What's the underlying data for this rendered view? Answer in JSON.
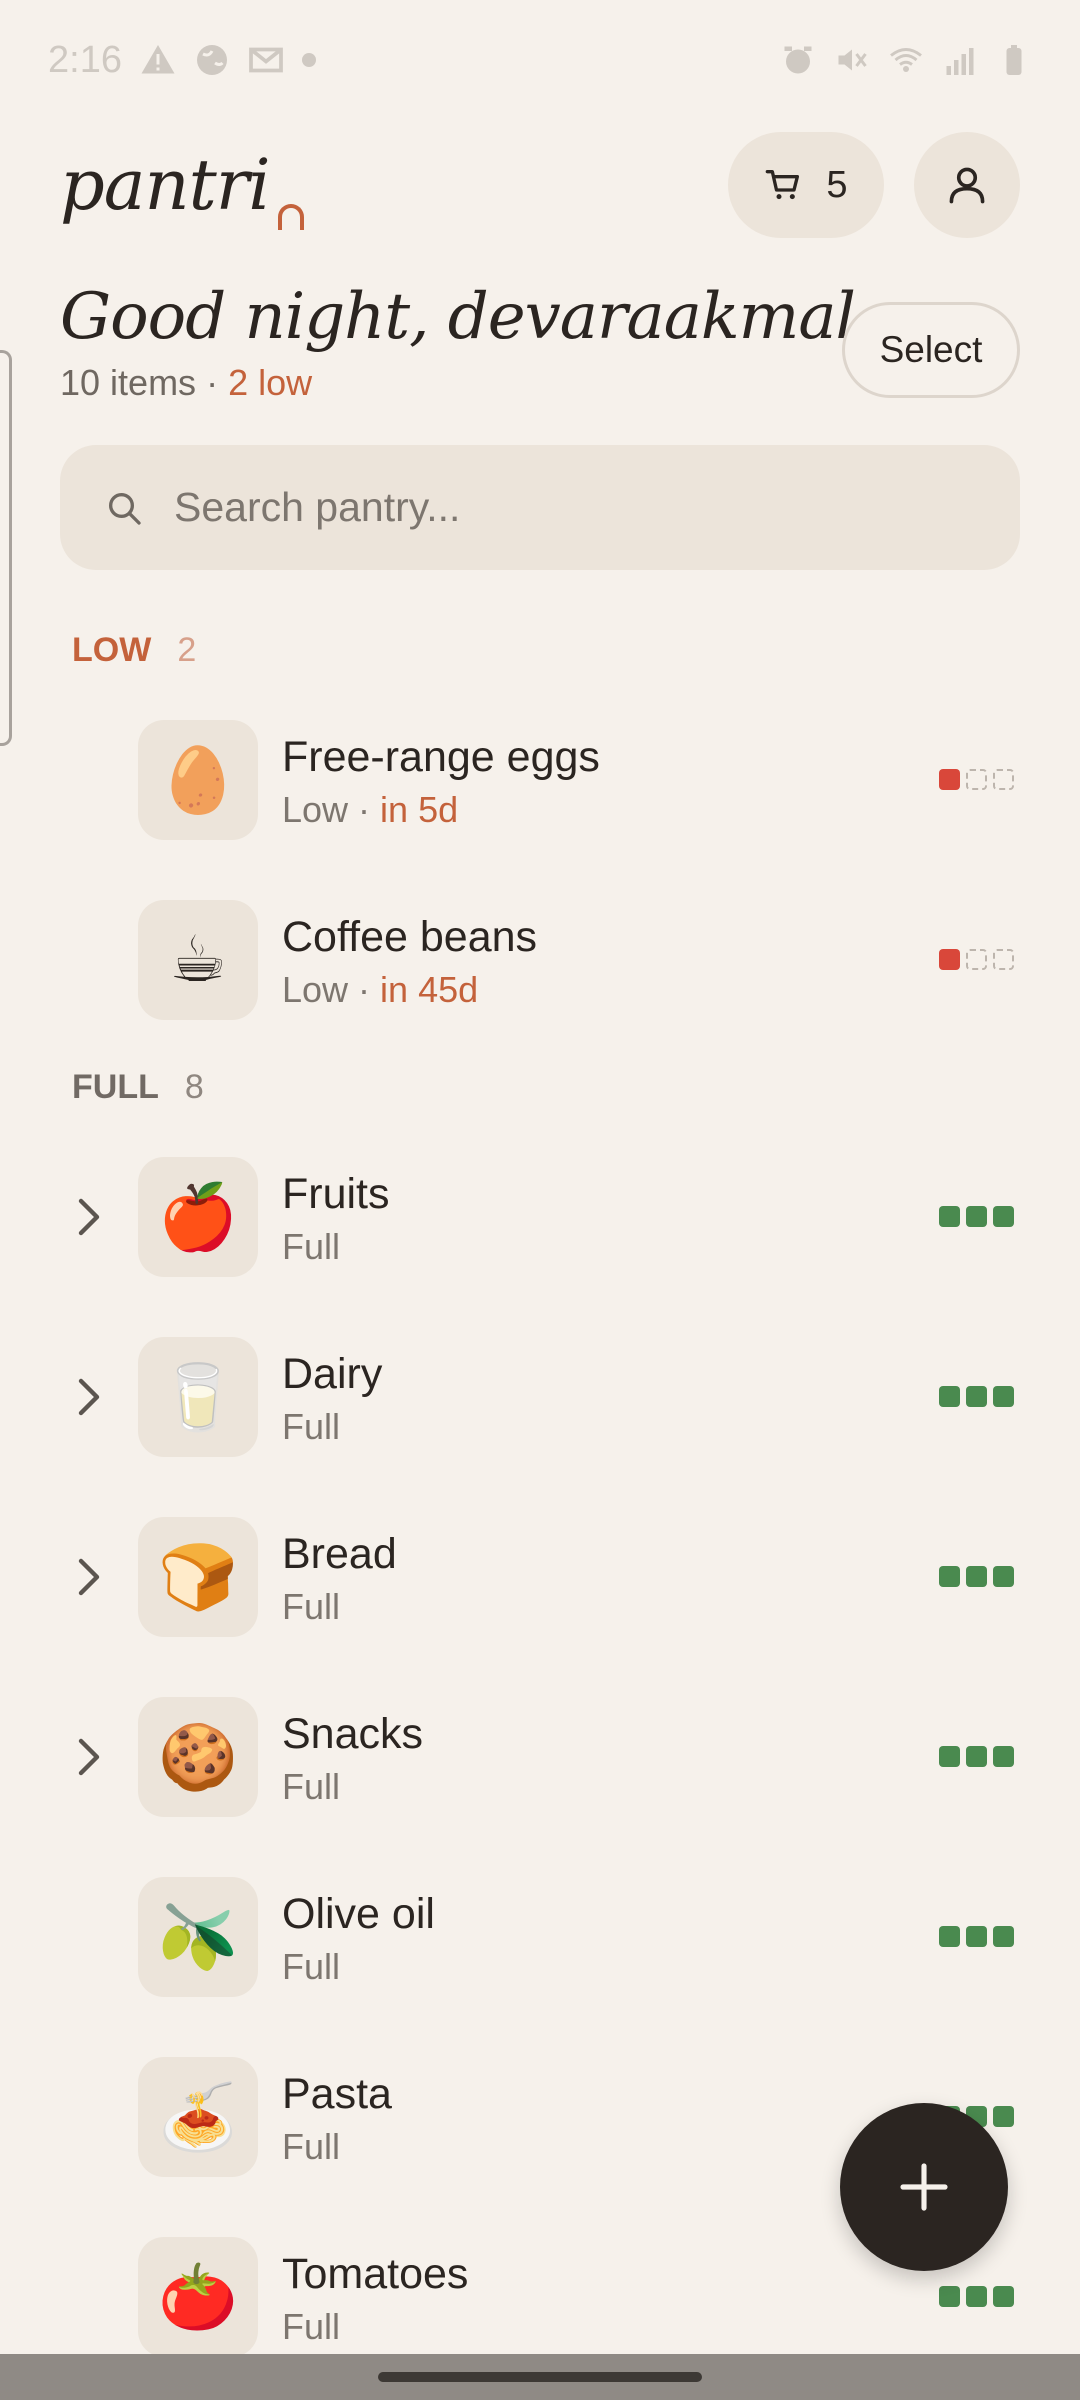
{
  "status_bar": {
    "time": "2:16"
  },
  "header": {
    "logo": "pantri",
    "cart_count": "5"
  },
  "greeting": "Good night, devaraakmal",
  "summary": {
    "items": "10 items",
    "separator": " · ",
    "low": "2 low"
  },
  "select_label": "Select",
  "search": {
    "placeholder": "Search pantry..."
  },
  "sections": {
    "low": {
      "label": "LOW",
      "count": "2"
    },
    "full": {
      "label": "FULL",
      "count": "8"
    }
  },
  "items": [
    {
      "name": "Free-range eggs",
      "status": "Low",
      "sep": " · ",
      "expiry": "in 5d",
      "emoji": "🥚",
      "level": 1,
      "expandable": false
    },
    {
      "name": "Coffee beans",
      "status": "Low",
      "sep": " · ",
      "expiry": "in 45d",
      "emoji": "☕",
      "level": 1,
      "expandable": false
    },
    {
      "name": "Fruits",
      "status": "Full",
      "emoji": "🍎",
      "level": 3,
      "expandable": true
    },
    {
      "name": "Dairy",
      "status": "Full",
      "emoji": "🥛",
      "level": 3,
      "expandable": true
    },
    {
      "name": "Bread",
      "status": "Full",
      "emoji": "🍞",
      "level": 3,
      "expandable": true
    },
    {
      "name": "Snacks",
      "status": "Full",
      "emoji": "🍪",
      "level": 3,
      "expandable": true
    },
    {
      "name": "Olive oil",
      "status": "Full",
      "emoji": "🫒",
      "level": 3,
      "expandable": false
    },
    {
      "name": "Pasta",
      "status": "Full",
      "emoji": "🍝",
      "level": 3,
      "expandable": false
    },
    {
      "name": "Tomatoes",
      "status": "Full",
      "emoji": "🍅",
      "level": 3,
      "expandable": false
    }
  ],
  "colors": {
    "background": "#f6f1eb",
    "accent": "#c4623b",
    "level_low": "#d9473a",
    "level_full": "#4a8a4f",
    "fab": "#2b2521"
  }
}
